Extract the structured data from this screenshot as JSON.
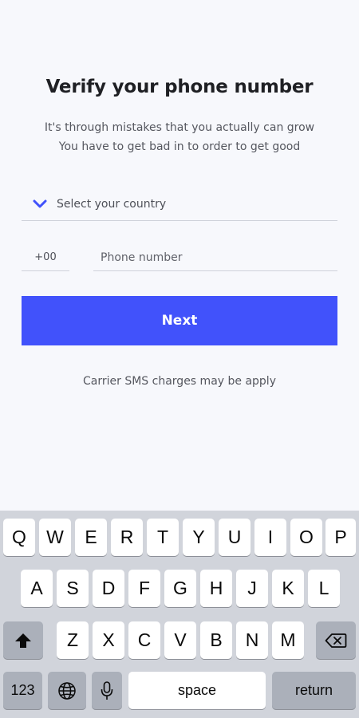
{
  "screen": {
    "title": "Verify your phone number",
    "subtitle_line1": "It's through mistakes that you actually can grow",
    "subtitle_line2": "You have to get bad in to order to get good",
    "country_placeholder": "Select your country",
    "country_code": "+00",
    "phone_placeholder": "Phone number",
    "next_label": "Next",
    "note": "Carrier SMS charges may be apply"
  },
  "colors": {
    "accent": "#4152fb",
    "background": "#f7f8fc",
    "keyboard": "#d1d4db"
  },
  "keyboard": {
    "row1": [
      "Q",
      "W",
      "E",
      "R",
      "T",
      "Y",
      "U",
      "I",
      "O",
      "P"
    ],
    "row2": [
      "A",
      "S",
      "D",
      "F",
      "G",
      "H",
      "J",
      "K",
      "L"
    ],
    "row3": [
      "Z",
      "X",
      "C",
      "V",
      "B",
      "N",
      "M"
    ],
    "numbers_label": "123",
    "space_label": "space",
    "return_label": "return",
    "icons": [
      "shift-icon",
      "backspace-icon",
      "globe-icon",
      "microphone-icon"
    ]
  }
}
